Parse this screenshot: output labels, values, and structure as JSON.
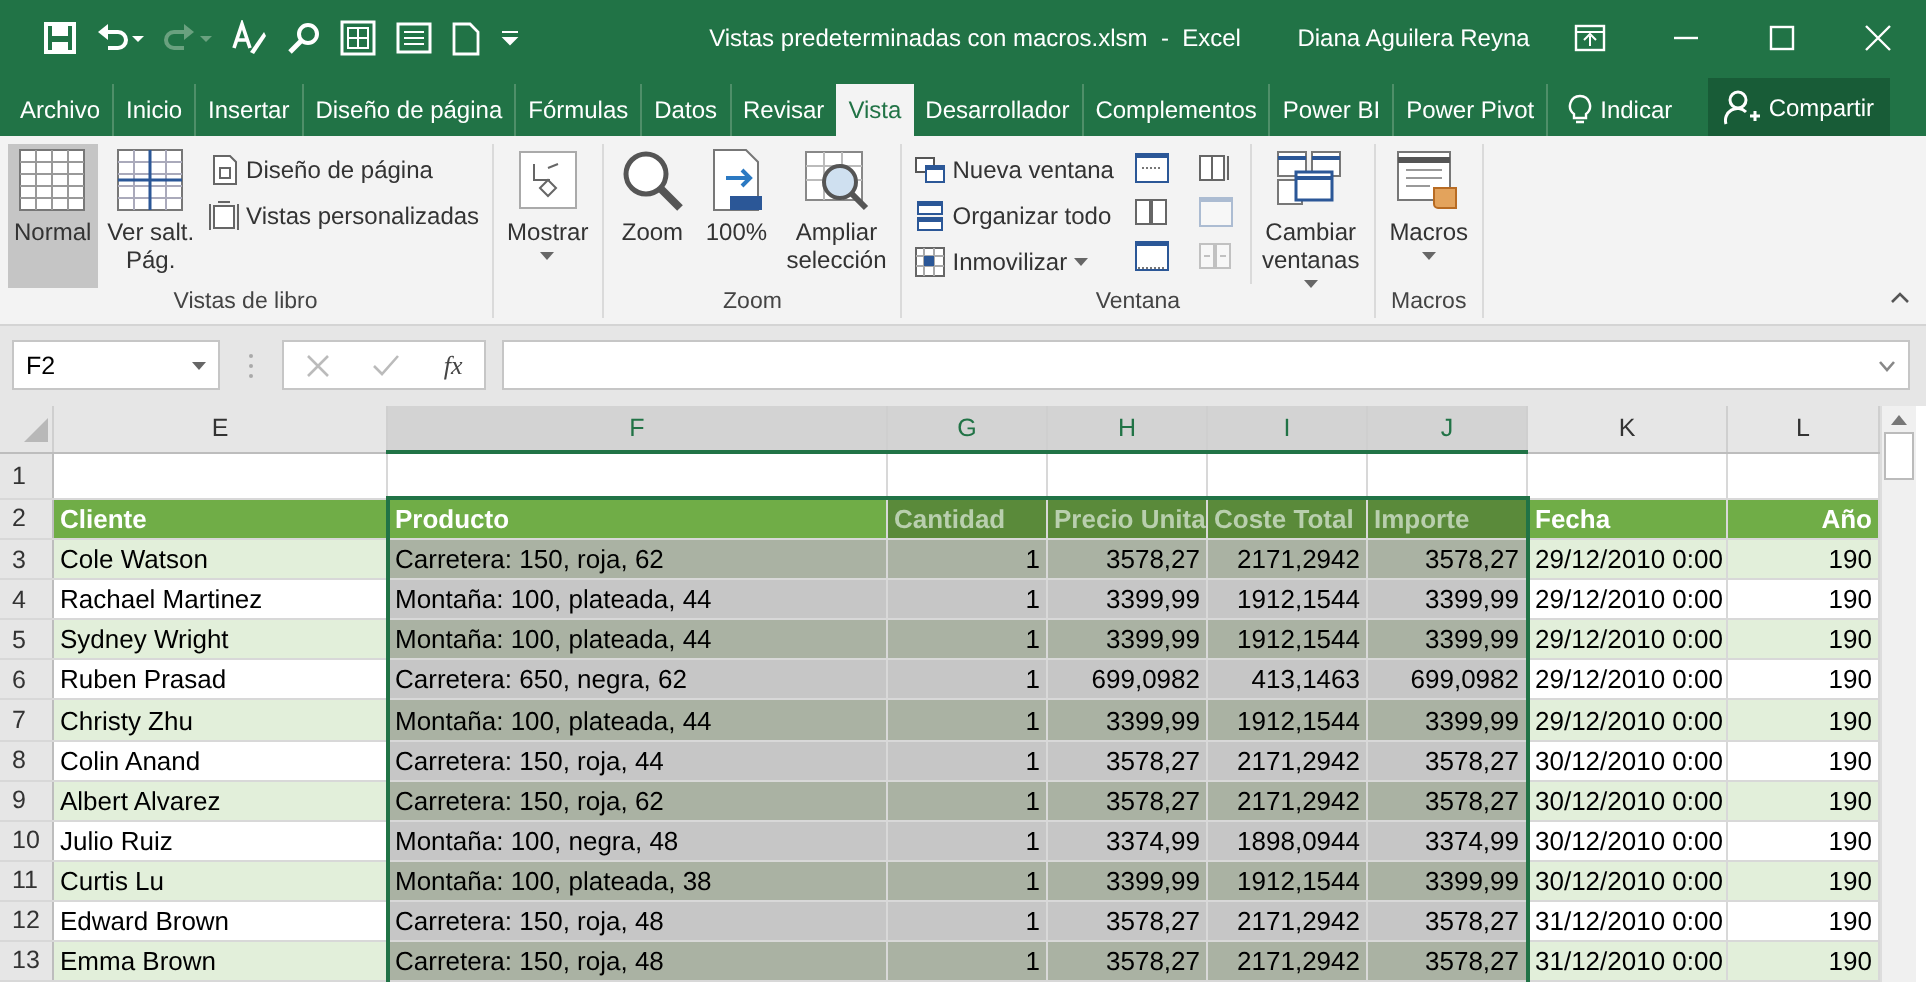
{
  "window": {
    "title": "Vistas predeterminadas con macros.xlsm  -  Excel",
    "user": "Diana Aguilera Reyna"
  },
  "tabs": [
    {
      "label": "Archivo",
      "selected": false
    },
    {
      "label": "Inicio",
      "selected": false
    },
    {
      "label": "Insertar",
      "selected": false
    },
    {
      "label": "Diseño de página",
      "selected": false
    },
    {
      "label": "Fórmulas",
      "selected": false
    },
    {
      "label": "Datos",
      "selected": false
    },
    {
      "label": "Revisar",
      "selected": false
    },
    {
      "label": "Vista",
      "selected": true
    },
    {
      "label": "Desarrollador",
      "selected": false
    },
    {
      "label": "Complementos",
      "selected": false
    },
    {
      "label": "Power BI",
      "selected": false
    },
    {
      "label": "Power Pivot",
      "selected": false
    }
  ],
  "tell_me": "Indicar",
  "share": "Compartir",
  "ribbon": {
    "groups": [
      {
        "label": "Vistas de libro",
        "items": [
          {
            "kind": "large",
            "label": "Normal",
            "selected": true
          },
          {
            "kind": "large",
            "label": "Ver salt.\nPág.",
            "selected": false
          },
          {
            "kind": "stack",
            "items": [
              {
                "label": "Diseño de página",
                "dropdown": false
              },
              {
                "label": "Vistas personalizadas",
                "dropdown": false
              }
            ]
          }
        ]
      },
      {
        "items": [
          {
            "kind": "large",
            "label": "Mostrar",
            "dropdown": true
          }
        ]
      },
      {
        "label": "Zoom",
        "items": [
          {
            "kind": "large",
            "label": "Zoom"
          },
          {
            "kind": "large",
            "label": "100%"
          },
          {
            "kind": "large",
            "label": "Ampliar\nselección"
          }
        ]
      },
      {
        "label": "Ventana",
        "items": [
          {
            "kind": "stack",
            "items": [
              {
                "label": "Nueva ventana",
                "dropdown": false
              },
              {
                "label": "Organizar todo",
                "dropdown": false
              },
              {
                "label": "Inmovilizar",
                "dropdown": true
              }
            ]
          },
          {
            "kind": "icons",
            "items": [
              {
                "disabled": false
              },
              {
                "disabled": false
              },
              {
                "disabled": false
              },
              {
                "disabled": false
              },
              {
                "disabled": true
              },
              {
                "disabled": true
              }
            ]
          },
          {
            "kind": "large",
            "label": "Cambiar\nventanas",
            "dropdown": true
          }
        ]
      },
      {
        "label": "Macros",
        "items": [
          {
            "kind": "large",
            "label": "Macros",
            "dropdown": true
          }
        ]
      }
    ]
  },
  "formula_bar": {
    "name_box": "F2",
    "function_label": "fx"
  },
  "sheet": {
    "columns": [
      {
        "label": "E",
        "selected": false,
        "active": false
      },
      {
        "label": "F",
        "selected": true,
        "active": true
      },
      {
        "label": "G",
        "selected": true,
        "active": false
      },
      {
        "label": "H",
        "selected": true,
        "active": false
      },
      {
        "label": "I",
        "selected": true,
        "active": false
      },
      {
        "label": "J",
        "selected": true,
        "active": false
      },
      {
        "label": "K",
        "selected": false,
        "active": false
      },
      {
        "label": "L",
        "selected": false,
        "active": false
      }
    ],
    "rows": [
      {
        "number": "1",
        "kind": "blank",
        "cells": []
      },
      {
        "number": "2",
        "kind": "header",
        "cells": [
          "Cliente",
          "Producto",
          "Cantidad",
          "Precio Unita",
          "Coste Total",
          "Importe",
          "Fecha",
          "Año"
        ]
      },
      {
        "number": "3",
        "kind": "data",
        "cells": [
          "Cole Watson",
          "Carretera: 150, roja, 62",
          "1",
          "3578,27",
          "2171,2942",
          "3578,27",
          "29/12/2010 0:00",
          "190"
        ]
      },
      {
        "number": "4",
        "kind": "data",
        "cells": [
          "Rachael Martinez",
          "Montaña: 100, plateada, 44",
          "1",
          "3399,99",
          "1912,1544",
          "3399,99",
          "29/12/2010 0:00",
          "190"
        ]
      },
      {
        "number": "5",
        "kind": "data",
        "cells": [
          "Sydney Wright",
          "Montaña: 100, plateada, 44",
          "1",
          "3399,99",
          "1912,1544",
          "3399,99",
          "29/12/2010 0:00",
          "190"
        ]
      },
      {
        "number": "6",
        "kind": "data",
        "cells": [
          "Ruben Prasad",
          "Carretera: 650, negra, 62",
          "1",
          "699,0982",
          "413,1463",
          "699,0982",
          "29/12/2010 0:00",
          "190"
        ]
      },
      {
        "number": "7",
        "kind": "data",
        "cells": [
          "Christy Zhu",
          "Montaña: 100, plateada, 44",
          "1",
          "3399,99",
          "1912,1544",
          "3399,99",
          "29/12/2010 0:00",
          "190"
        ]
      },
      {
        "number": "8",
        "kind": "data",
        "cells": [
          "Colin Anand",
          "Carretera: 150, roja, 44",
          "1",
          "3578,27",
          "2171,2942",
          "3578,27",
          "30/12/2010 0:00",
          "190"
        ]
      },
      {
        "number": "9",
        "kind": "data",
        "cells": [
          "Albert Alvarez",
          "Carretera: 150, roja, 62",
          "1",
          "3578,27",
          "2171,2942",
          "3578,27",
          "30/12/2010 0:00",
          "190"
        ]
      },
      {
        "number": "10",
        "kind": "data",
        "cells": [
          "Julio Ruiz",
          "Montaña: 100, negra, 48",
          "1",
          "3374,99",
          "1898,0944",
          "3374,99",
          "30/12/2010 0:00",
          "190"
        ]
      },
      {
        "number": "11",
        "kind": "data",
        "cells": [
          "Curtis Lu",
          "Montaña: 100, plateada, 38",
          "1",
          "3399,99",
          "1912,1544",
          "3399,99",
          "30/12/2010 0:00",
          "190"
        ]
      },
      {
        "number": "12",
        "kind": "data",
        "cells": [
          "Edward Brown",
          "Carretera: 150, roja, 48",
          "1",
          "3578,27",
          "2171,2942",
          "3578,27",
          "31/12/2010 0:00",
          "190"
        ]
      },
      {
        "number": "13",
        "kind": "data",
        "cells": [
          "Emma Brown",
          "Carretera: 150, roja, 48",
          "1",
          "3578,27",
          "2171,2942",
          "3578,27",
          "31/12/2010 0:00",
          "190"
        ]
      }
    ]
  }
}
